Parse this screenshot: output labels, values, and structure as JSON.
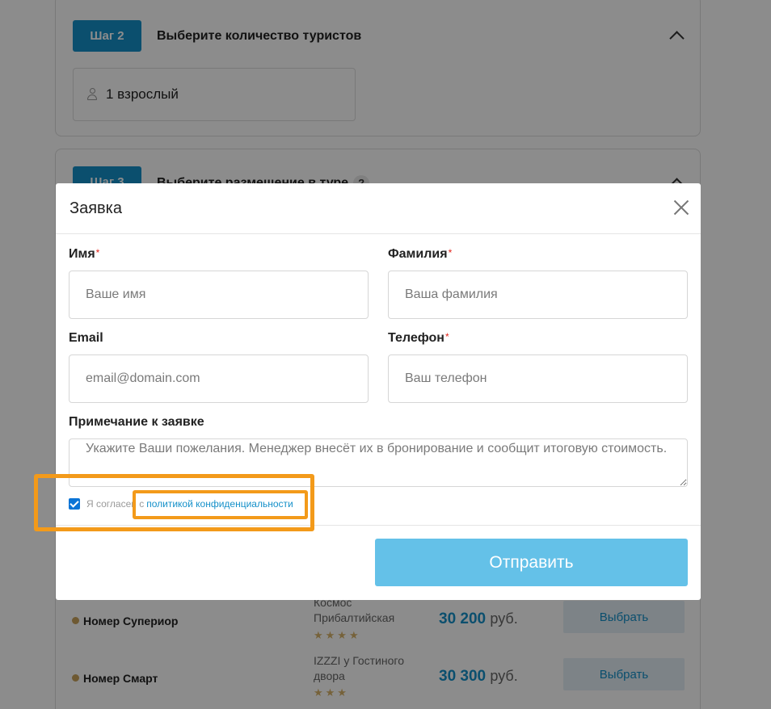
{
  "steps": [
    {
      "badge": "Шаг 2",
      "title": "Выберите количество туристов",
      "tourists": "1 взрослый"
    },
    {
      "badge": "Шаг 3",
      "title": "Выберите размещение в туре",
      "help": "?"
    }
  ],
  "rooms": [
    {
      "name": "Номер Супериор",
      "hotel": "Космос Прибалтийская",
      "stars": "★★★★",
      "price": "30 200",
      "currency": "руб.",
      "action": "Выбрать"
    },
    {
      "name": "Номер Смарт",
      "hotel": "IZZZI у Гостиного двора",
      "stars": "★★★",
      "price": "30 300",
      "currency": "руб.",
      "action": "Выбрать"
    }
  ],
  "modal": {
    "title": "Заявка",
    "first_name": {
      "label": "Имя",
      "placeholder": "Ваше имя"
    },
    "last_name": {
      "label": "Фамилия",
      "placeholder": "Ваша фамилия"
    },
    "email": {
      "label": "Email",
      "placeholder": "email@domain.com"
    },
    "phone": {
      "label": "Телефон",
      "placeholder": "Ваш телефон"
    },
    "note": {
      "label": "Примечание к заявке",
      "placeholder": "Укажите Ваши пожелания. Менеджер внесёт их в бронирование и сообщит итоговую стоимость."
    },
    "required_mark": "*",
    "consent_text": "Я согласен с",
    "consent_link": "политикой конфиденциальности",
    "submit_label": "Отправить"
  },
  "colors": {
    "accent": "#1490c9",
    "submit": "#64c1e8",
    "highlight": "#f39a1a",
    "required": "#e2231a"
  },
  "icons": [
    "person-icon",
    "chevron-up-icon",
    "close-icon",
    "checkbox-checked-icon",
    "star-icon"
  ]
}
